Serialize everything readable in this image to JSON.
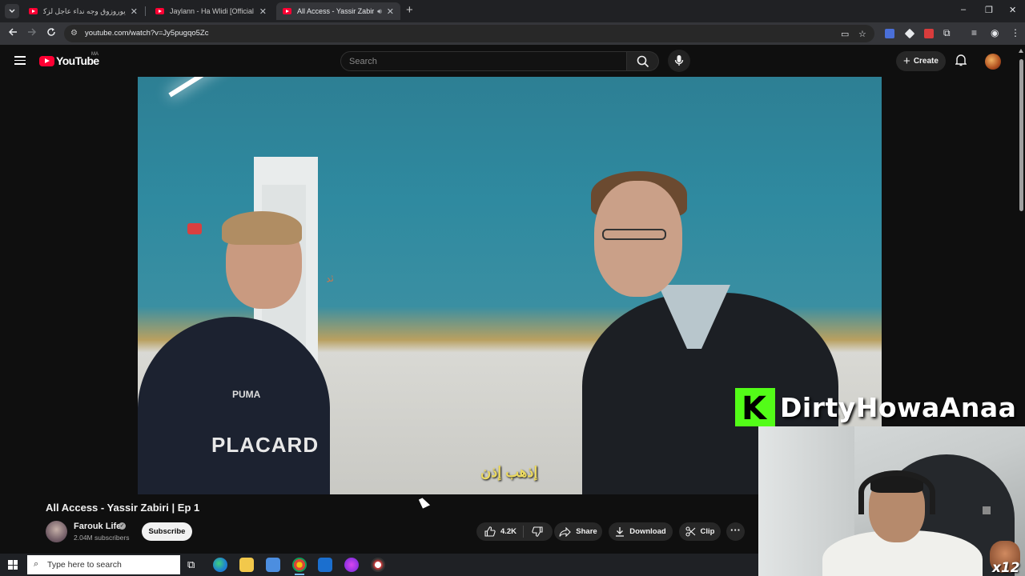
{
  "browser": {
    "tabs": [
      {
        "title": "يوروزوق وجه نداء عاجل لزكراكي وه",
        "active": false
      },
      {
        "title": "Jaylann - Ha Wlidi [Official Mus",
        "active": false
      },
      {
        "title": "All Access - Yassir Zabiri | Ep",
        "active": true,
        "audio": true
      }
    ],
    "new_tab_label": "+",
    "url": "youtube.com/watch?v=Jy5pugqo5Zc",
    "window_controls": {
      "minimize": "–",
      "restore": "❐",
      "close": "✕"
    }
  },
  "youtube": {
    "logo_text": "YouTube",
    "country_code": "MA",
    "search_placeholder": "Search",
    "create_label": "Create"
  },
  "video": {
    "subtitle": "إذهب إذن",
    "jersey_text": "PLACARD",
    "brand_text": "PUMA",
    "title": "All Access - Yassir Zabiri | Ep 1"
  },
  "channel": {
    "name": "Farouk Life",
    "subscribers": "2.04M subscribers",
    "subscribe_label": "Subscribe"
  },
  "actions": {
    "likes": "4.2K",
    "share_label": "Share",
    "download_label": "Download",
    "clip_label": "Clip",
    "more_label": "···"
  },
  "overlay": {
    "streamer_name": "DirtyHowaAnaa",
    "kick_letter": "K",
    "badge_text": "x12"
  },
  "taskbar": {
    "search_placeholder": "Type here to search"
  },
  "colors": {
    "youtube_red": "#ff0033",
    "kick_green": "#53fc18",
    "background": "#0f0f0f"
  }
}
